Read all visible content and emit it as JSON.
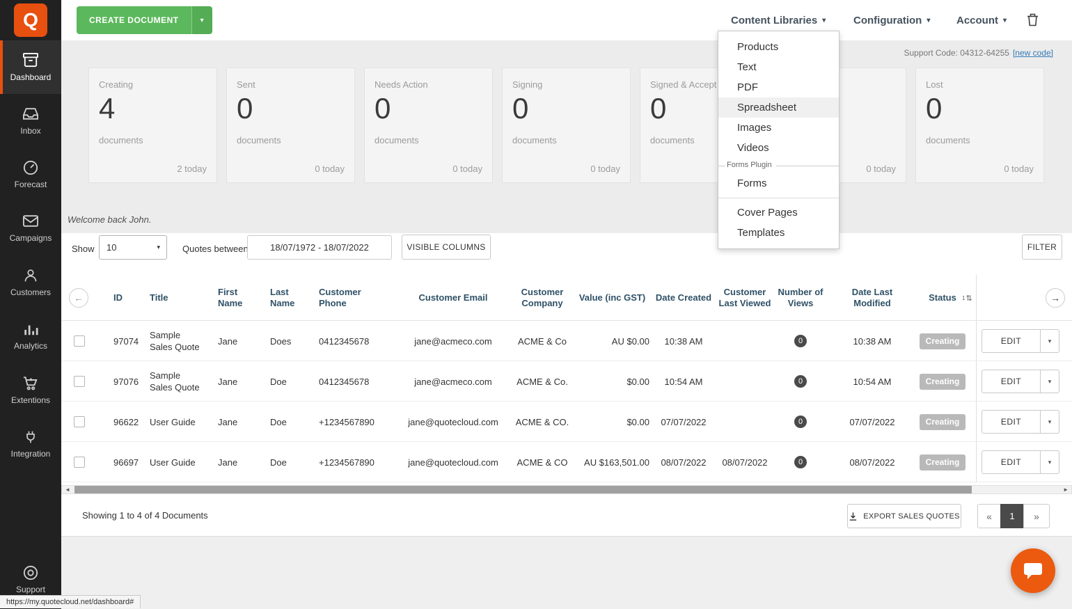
{
  "app": {
    "logo_letter": "Q"
  },
  "topbar": {
    "create_button_label": "CREATE DOCUMENT",
    "nav_items": [
      {
        "label": "Content Libraries"
      },
      {
        "label": "Configuration"
      },
      {
        "label": "Account"
      }
    ]
  },
  "sidebar": {
    "items": [
      {
        "label": "Dashboard",
        "icon": "dashboard-icon",
        "active": true
      },
      {
        "label": "Inbox",
        "icon": "inbox-icon",
        "active": false
      },
      {
        "label": "Forecast",
        "icon": "forecast-icon",
        "active": false
      },
      {
        "label": "Campaigns",
        "icon": "campaigns-icon",
        "active": false
      },
      {
        "label": "Customers",
        "icon": "customers-icon",
        "active": false
      },
      {
        "label": "Analytics",
        "icon": "analytics-icon",
        "active": false
      },
      {
        "label": "Extentions",
        "icon": "extensions-icon",
        "active": false
      },
      {
        "label": "Integration",
        "icon": "integration-icon",
        "active": false
      }
    ],
    "support": {
      "label": "Support",
      "icon": "support-icon"
    }
  },
  "content_libraries_menu": {
    "items": [
      {
        "label": "Products",
        "highlighted": false
      },
      {
        "label": "Text",
        "highlighted": false
      },
      {
        "label": "PDF",
        "highlighted": false
      },
      {
        "label": "Spreadsheet",
        "highlighted": true
      },
      {
        "label": "Images",
        "highlighted": false
      },
      {
        "label": "Videos",
        "highlighted": false
      }
    ],
    "forms_section_label": "Forms Plugin",
    "forms_item": "Forms",
    "footer_items": [
      {
        "label": "Cover Pages"
      },
      {
        "label": "Templates"
      }
    ]
  },
  "stats_header": {
    "support_code_text": "Support Code: 04312-64255",
    "new_code_link": "[new code]"
  },
  "stat_cards": [
    {
      "label": "Creating",
      "count": "4",
      "unit": "documents",
      "today": "2 today"
    },
    {
      "label": "Sent",
      "count": "0",
      "unit": "documents",
      "today": "0 today"
    },
    {
      "label": "Needs Action",
      "count": "0",
      "unit": "documents",
      "today": "0 today"
    },
    {
      "label": "Signing",
      "count": "0",
      "unit": "documents",
      "today": "0 today"
    },
    {
      "label": "Signed & Accept",
      "count": "0",
      "unit": "documents",
      "today": ""
    },
    {
      "label": "",
      "count": "",
      "unit": "",
      "today": "0 today"
    },
    {
      "label": "Lost",
      "count": "0",
      "unit": "documents",
      "today": "0 today"
    }
  ],
  "welcome_text": "Welcome back John.",
  "toolbar": {
    "show_label": "Show",
    "show_value": "10",
    "quotes_between_label": "Quotes between",
    "date_range": "18/07/1972 - 18/07/2022",
    "visible_columns_label": "VISIBLE COLUMNS",
    "filter_label": "FILTER"
  },
  "table": {
    "columns": [
      "ID",
      "Title",
      "First Name",
      "Last Name",
      "Customer Phone",
      "Customer Email",
      "Customer Company",
      "Value (inc GST)",
      "Date Created",
      "Customer Last Viewed",
      "Number of Views",
      "Date Last Modified",
      "Status"
    ],
    "rows": [
      {
        "id": "97074",
        "title": "Sample Sales Quote",
        "first_name": "Jane",
        "last_name": "Does",
        "phone": "0412345678",
        "email": "jane@acmeco.com",
        "company": "ACME & Co",
        "value": "AU $0.00",
        "date_created": "10:38 AM",
        "last_viewed": "",
        "views": "0",
        "date_modified": "10:38 AM",
        "status": "Creating",
        "edit_label": "EDIT"
      },
      {
        "id": "97076",
        "title": "Sample Sales Quote",
        "first_name": "Jane",
        "last_name": "Doe",
        "phone": "0412345678",
        "email": "jane@acmeco.com",
        "company": "ACME & Co.",
        "value": "$0.00",
        "date_created": "10:54 AM",
        "last_viewed": "",
        "views": "0",
        "date_modified": "10:54 AM",
        "status": "Creating",
        "edit_label": "EDIT"
      },
      {
        "id": "96622",
        "title": "User Guide",
        "first_name": "Jane",
        "last_name": "Doe",
        "phone": "+1234567890",
        "email": "jane@quotecloud.com",
        "company": "ACME & CO.",
        "value": "$0.00",
        "date_created": "07/07/2022",
        "last_viewed": "",
        "views": "0",
        "date_modified": "07/07/2022",
        "status": "Creating",
        "edit_label": "EDIT"
      },
      {
        "id": "96697",
        "title": "User Guide",
        "first_name": "Jane",
        "last_name": "Doe",
        "phone": "+1234567890",
        "email": "jane@quotecloud.com",
        "company": "ACME & CO",
        "value": "AU $163,501.00",
        "date_created": "08/07/2022",
        "last_viewed": "08/07/2022",
        "views": "0",
        "date_modified": "08/07/2022",
        "status": "Creating",
        "edit_label": "EDIT"
      }
    ]
  },
  "footer": {
    "showing_text": "Showing 1 to 4 of 4 Documents",
    "export_label": "EXPORT SALES QUOTES",
    "current_page": "1"
  },
  "status_bar_url": "https://my.quotecloud.net/dashboard#",
  "icons": {
    "chevron_down": "▾",
    "back_arrow": "←",
    "forward_arrow": "→",
    "scroll_left": "◄",
    "scroll_right": "►",
    "page_prev": "«",
    "page_next": "»",
    "sort_arrows": "⇅",
    "sort_badge": "1"
  },
  "colors": {
    "accent_orange": "#e8500f",
    "primary_green": "#5cb85c",
    "link_blue": "#337ab7",
    "status_badge_gray": "#b9b9b9",
    "sidebar_dark": "#212121",
    "header_text": "#2f5166"
  }
}
